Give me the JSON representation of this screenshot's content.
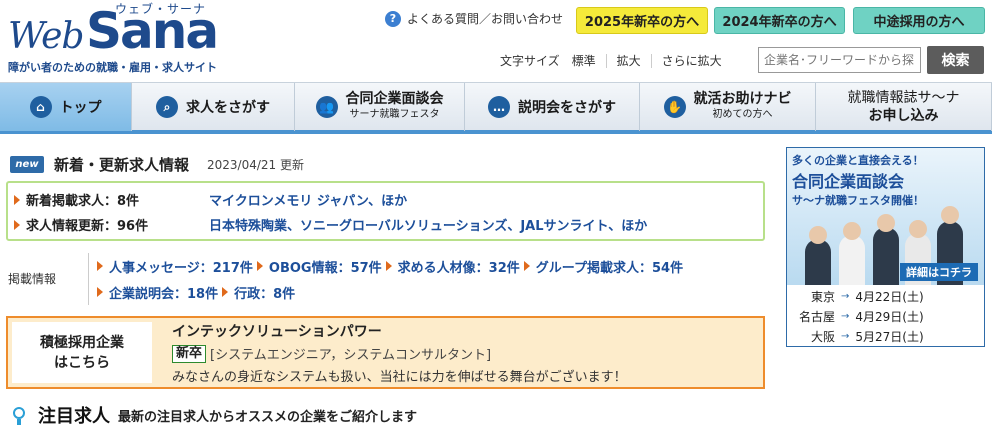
{
  "header": {
    "logo_kana": "ウェブ・サーナ",
    "logo_web": "Web",
    "logo_sana": "Sana",
    "logo_sub": "障がい者のための就職・雇用・求人サイト",
    "faq": "よくある質問／お問い合わせ",
    "btn_2025": "2025年新卒の方へ",
    "btn_2024": "2024年新卒の方へ",
    "btn_career": "中途採用の方へ",
    "fontsize_label": "文字サイズ",
    "fontsize_options": [
      "標準",
      "拡大",
      "さらに拡大"
    ],
    "search_placeholder": "企業名･フリーワードから探",
    "search_btn": "検索"
  },
  "nav": {
    "items": [
      {
        "label": "トップ",
        "sub": ""
      },
      {
        "label": "求人をさがす",
        "sub": ""
      },
      {
        "label": "合同企業面談会",
        "sub": "サーナ就職フェスタ"
      },
      {
        "label": "説明会をさがす",
        "sub": ""
      },
      {
        "label": "就活お助けナビ",
        "sub": "初めての方へ"
      }
    ],
    "last_line1": "就職情報誌サ～ナ",
    "last_line2": "お申し込み"
  },
  "news": {
    "badge": "new",
    "title": "新着・更新求人情報",
    "date": "2023/04/21 更新",
    "rows": [
      {
        "label": "新着掲載求人：8件",
        "value": "マイクロンメモリ ジャパン、ほか"
      },
      {
        "label": "求人情報更新：96件",
        "value": "日本特殊陶業、ソニーグローバルソリューションズ、JALサンライト、ほか"
      }
    ]
  },
  "info": {
    "label": "掲載情報",
    "line1": [
      "人事メッセージ：217件",
      "OBOG情報：57件",
      "求める人材像：32件",
      "グループ掲載求人：54件"
    ],
    "line2": [
      "企業説明会：18件",
      "行政：8件"
    ]
  },
  "featured": {
    "left_line1": "積極採用企業",
    "left_line2": "はこちら",
    "company": "インテックソリューションパワー",
    "tag": "新卒",
    "positions": "[システムエンジニア，システムコンサルタント]",
    "desc": "みなさんの身近なシステムも扱い、当社には力を伸ばせる舞台がございます！"
  },
  "attention": {
    "title": "注目求人",
    "sub": "最新の注目求人からオススメの企業をご紹介します"
  },
  "ad": {
    "line1": "多くの企業と直接会える！",
    "line2": "合同企業面談会",
    "line3": "サ～ナ就職フェスタ開催！",
    "more": "詳細はコチラ",
    "schedule": [
      {
        "city": "東京",
        "date": "4月22日(土)"
      },
      {
        "city": "名古屋",
        "date": "4月29日(土)"
      },
      {
        "city": "大阪",
        "date": "5月27日(土)"
      }
    ]
  },
  "colors": {
    "brand": "#1e4a8c",
    "nav_active": "#7fbbe6",
    "accent_orange": "#ee8c2c",
    "accent_green": "#b8e08a"
  }
}
